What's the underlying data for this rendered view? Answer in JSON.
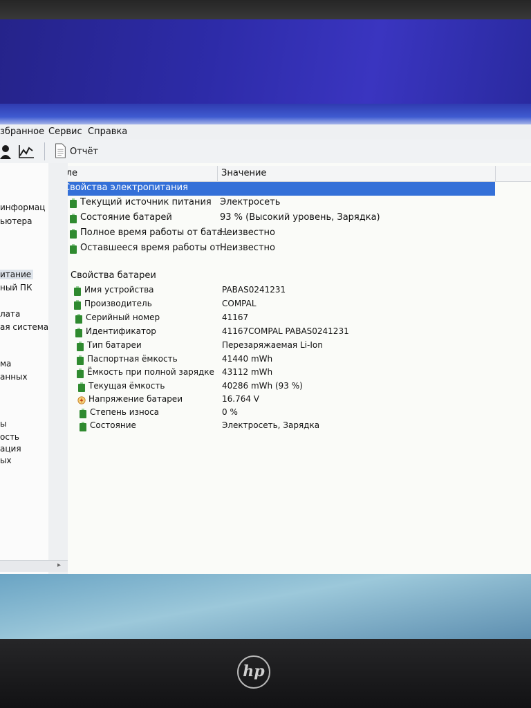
{
  "menu": [
    "збранное",
    "Сервис",
    "Справка"
  ],
  "toolbar": {
    "report_label": "Отчёт"
  },
  "left_pane": {
    "items": [
      "информац",
      "ьютера",
      "итание",
      "ный ПК",
      "лата",
      "ая система",
      "ма",
      "анных",
      "ы",
      "ость",
      "ация",
      "ых"
    ],
    "selected": "итание"
  },
  "columns": {
    "field": "Поле",
    "value": "Значение"
  },
  "power_group": {
    "title": "Свойства электропитания",
    "rows": [
      {
        "field": "Текущий источник питания",
        "value": "Электросеть"
      },
      {
        "field": "Состояние батарей",
        "value": "93 % (Высокий уровень, Зарядка)"
      },
      {
        "field": "Полное время работы от бата...",
        "value": "Неизвестно"
      },
      {
        "field": "Оставшееся время работы от ...",
        "value": "Неизвестно"
      }
    ]
  },
  "battery_group": {
    "title": "Свойства батареи",
    "rows": [
      {
        "field": "Имя устройства",
        "value": "PABAS0241231",
        "icon": "battery-icon"
      },
      {
        "field": "Производитель",
        "value": "COMPAL",
        "icon": "battery-icon"
      },
      {
        "field": "Серийный номер",
        "value": "41167",
        "icon": "battery-icon"
      },
      {
        "field": "Идентификатор",
        "value": "41167COMPAL PABAS0241231",
        "icon": "battery-icon"
      },
      {
        "field": "Тип батареи",
        "value": "Перезаряжаемая Li-Ion",
        "icon": "battery-icon"
      },
      {
        "field": "Паспортная ёмкость",
        "value": "41440 mWh",
        "icon": "battery-icon"
      },
      {
        "field": "Ёмкость при полной зарядке",
        "value": "43112 mWh",
        "icon": "battery-icon"
      },
      {
        "field": "Текущая ёмкость",
        "value": "40286 mWh  (93 %)",
        "icon": "battery-icon"
      },
      {
        "field": "Напряжение батареи",
        "value": "16.764 V",
        "icon": "voltage-icon"
      },
      {
        "field": "Степень износа",
        "value": "0 %",
        "icon": "battery-icon"
      },
      {
        "field": "Состояние",
        "value": "Электросеть, Зарядка",
        "icon": "battery-icon"
      }
    ]
  },
  "colors": {
    "selection": "#3470d8",
    "battery_green": "#2f8a2f"
  },
  "logo": "hp"
}
